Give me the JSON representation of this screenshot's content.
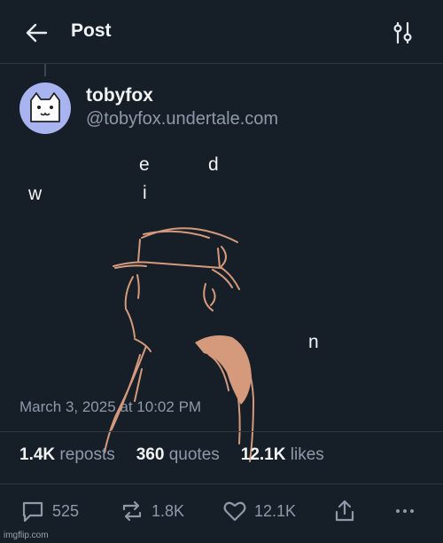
{
  "header": {
    "title": "Post",
    "back_icon": "arrow-left-icon",
    "filter_icon": "sliders-icon"
  },
  "author": {
    "display_name": "tobyfox",
    "handle": "@tobyfox.undertale.com",
    "avatar_icon": "white-cat-face-icon",
    "avatar_bg": "#a8b4f0"
  },
  "post": {
    "letters": [
      "e",
      "d",
      "w",
      "i",
      "n"
    ]
  },
  "artwork": {
    "description_icon": "silhouette-hat-figure-icon",
    "stroke_color": "#d59a7c"
  },
  "timestamp": "March 3, 2025 at 10:02 PM",
  "stats": {
    "reposts_count": "1.4K",
    "reposts_label": "reposts",
    "quotes_count": "360",
    "quotes_label": "quotes",
    "likes_count": "12.1K",
    "likes_label": "likes"
  },
  "actions": {
    "replies": "525",
    "reposts": "1.8K",
    "likes": "12.1K"
  },
  "watermark": "imgflip.com",
  "colors": {
    "background": "#161e27",
    "text": "#e8ebee",
    "muted": "#8e9aa8",
    "divider": "#2e3946"
  }
}
